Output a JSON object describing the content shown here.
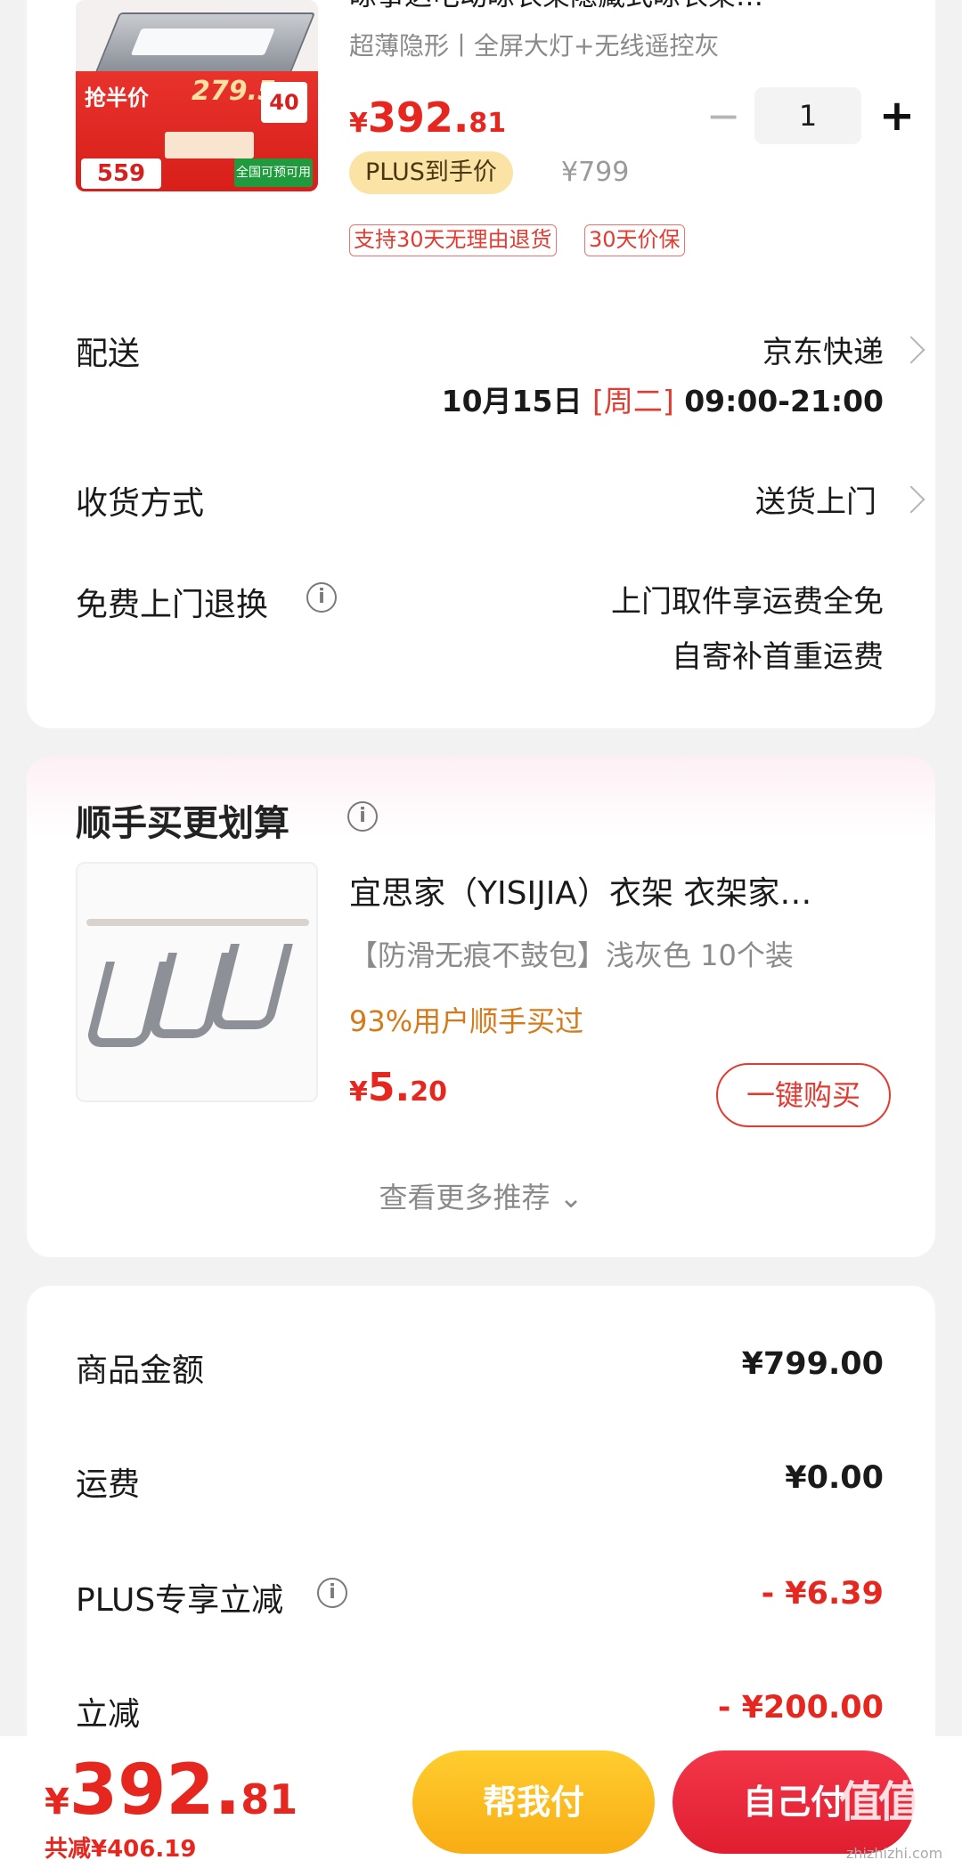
{
  "product": {
    "title": "晾事达电动晾衣架隐藏式晾衣架…",
    "spec": "超薄隐形丨全屏大灯+无线遥控灰",
    "price_yen": "¥",
    "price_int": "392.",
    "price_dec": "81",
    "plus_badge": "PLUS到手价",
    "original_price": "¥799",
    "quantity": "1",
    "minus_symbol": "−",
    "plus_symbol": "+",
    "tags": [
      "支持30天无理由退货",
      "30天价保"
    ],
    "image_text": {
      "promo": "抢半价",
      "promo_price": "279.5",
      "coupon": "40",
      "price_box": "559",
      "green_label": "全国可预可用"
    }
  },
  "delivery": {
    "label": "配送",
    "carrier": "京东快递",
    "date": "10月15日 ",
    "day": "[周二]",
    "time": " 09:00-21:00"
  },
  "receive": {
    "label": "收货方式",
    "value": "送货上门"
  },
  "free_return": {
    "label": "免费上门退换",
    "line1": "上门取件享运费全免",
    "line2": "自寄补首重运费"
  },
  "recommend": {
    "title": "顺手买更划算",
    "item_name": "宜思家（YISIJIA）衣架 衣架家…",
    "item_spec": "【防滑无痕不鼓包】浅灰色   10个装",
    "bought": "93%用户顺手买过",
    "price_yen": "¥",
    "price_int": "5.",
    "price_dec": "20",
    "buy_button": "一键购买",
    "more": "查看更多推荐 ⌄"
  },
  "amounts": {
    "goods_label": "商品金额",
    "goods_value": "¥799.00",
    "shipping_label": "运费",
    "shipping_value": "¥0.00",
    "plus_label": "PLUS专享立减",
    "plus_value": "- ¥6.39",
    "discount_label": "立减",
    "discount_value": "- ¥200.00"
  },
  "bottom": {
    "total_yen": "¥",
    "total_int": "392.",
    "total_dec": "81",
    "saved": "共减¥406.19",
    "help_pay": "帮我付",
    "self_pay": "自己付",
    "watermark": "值值值",
    "watermark_url": "zhizhizhi.com"
  },
  "colors": {
    "accent_red": "#e52720",
    "plus_gold": "#fbe3a5",
    "help_yellow": "#f8ad14",
    "pay_red": "#e01e30"
  }
}
